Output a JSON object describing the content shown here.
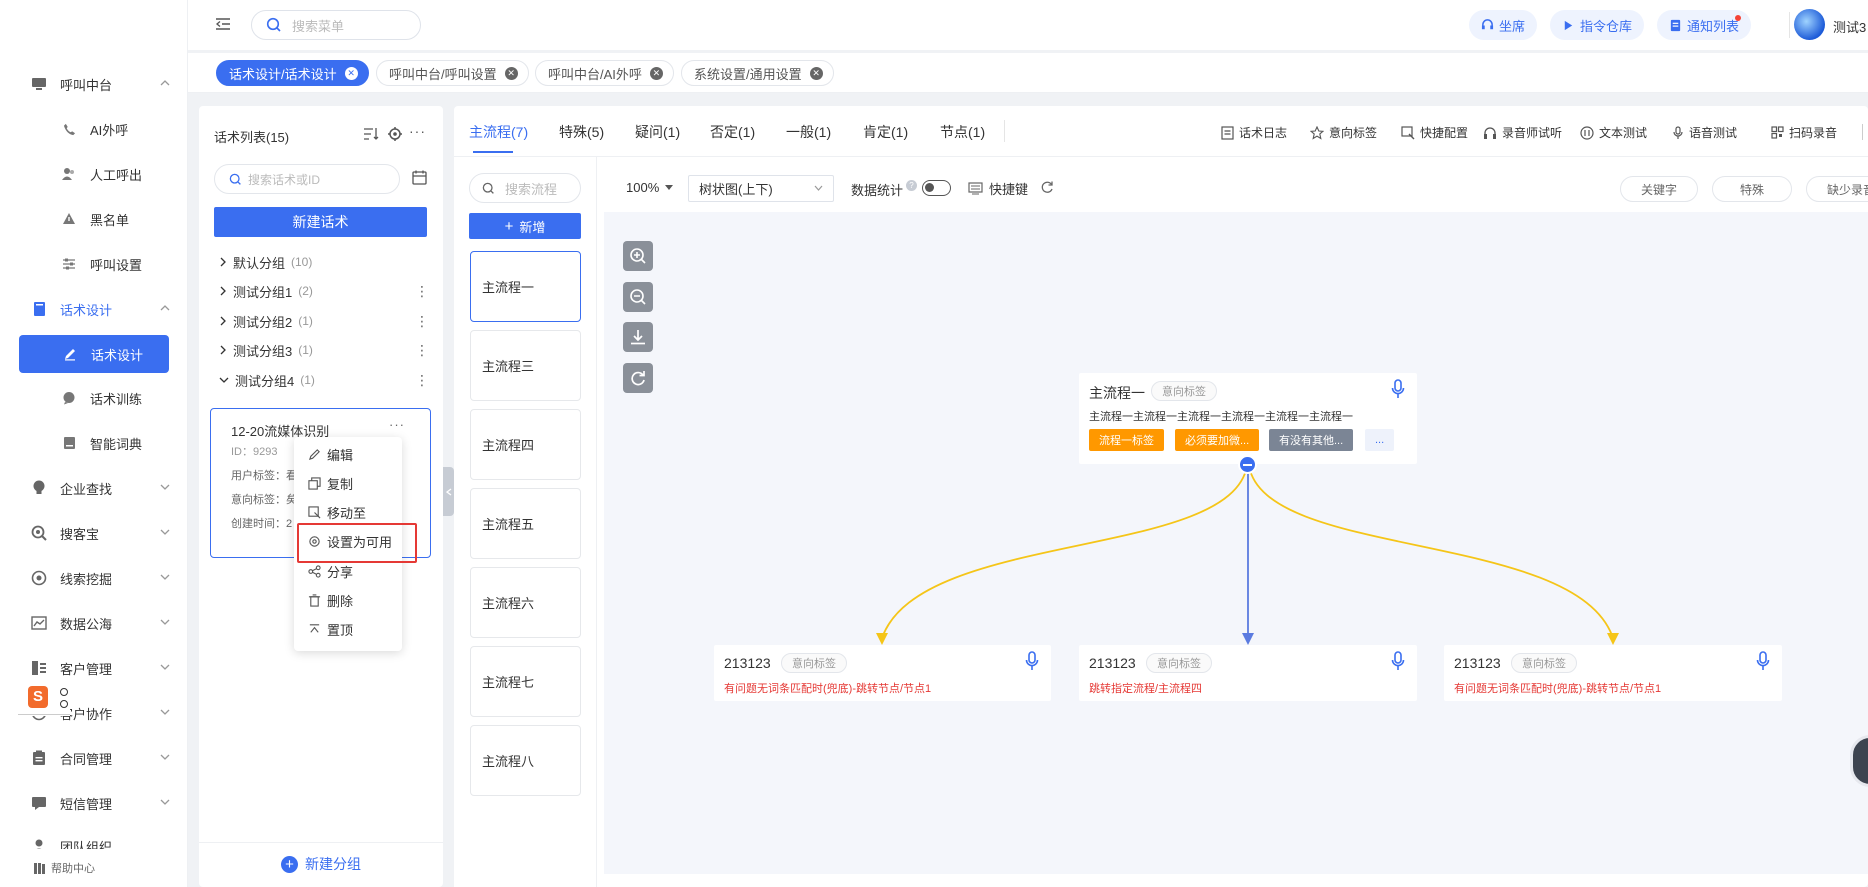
{
  "sidebar": {
    "items": [
      {
        "label": "呼叫中台",
        "icon": "monitor-icon"
      },
      {
        "label": "AI外呼",
        "icon": "phone-icon"
      },
      {
        "label": "人工呼出",
        "icon": "people-icon"
      },
      {
        "label": "黑名单",
        "icon": "warning-icon"
      },
      {
        "label": "呼叫设置",
        "icon": "sliders-icon"
      },
      {
        "label": "话术设计",
        "icon": "book-icon"
      },
      {
        "label": "话术设计",
        "icon": "edit-icon"
      },
      {
        "label": "话术训练",
        "icon": "chat-icon"
      },
      {
        "label": "智能词典",
        "icon": "dictionary-icon"
      },
      {
        "label": "企业查找",
        "icon": "bulb-icon"
      },
      {
        "label": "搜客宝",
        "icon": "search-circle-icon"
      },
      {
        "label": "线索挖掘",
        "icon": "target-icon"
      },
      {
        "label": "数据公海",
        "icon": "chart-icon"
      },
      {
        "label": "客户管理",
        "icon": "customer-icon"
      },
      {
        "label": "客户协作",
        "icon": "collab-icon"
      },
      {
        "label": "合同管理",
        "icon": "contract-icon"
      },
      {
        "label": "短信管理",
        "icon": "sms-icon"
      },
      {
        "label": "团队组织",
        "icon": "team-icon"
      }
    ],
    "help": "帮助中心"
  },
  "header": {
    "search_placeholder": "搜索菜单",
    "seat": "坐席",
    "command": "指令仓库",
    "notify": "通知列表",
    "user": "测试3"
  },
  "tabs": [
    {
      "label": "话术设计/话术设计",
      "active": true
    },
    {
      "label": "呼叫中台/呼叫设置",
      "active": false
    },
    {
      "label": "呼叫中台/AI外呼",
      "active": false
    },
    {
      "label": "系统设置/通用设置",
      "active": false
    }
  ],
  "script_list": {
    "title": "话术列表(15)",
    "search_placeholder": "搜索话术或ID",
    "new_btn": "新建话术",
    "groups": [
      {
        "name": "默认分组",
        "count": "(10)"
      },
      {
        "name": "测试分组1",
        "count": "(2)"
      },
      {
        "name": "测试分组2",
        "count": "(1)"
      },
      {
        "name": "测试分组3",
        "count": "(1)"
      },
      {
        "name": "测试分组4",
        "count": "(1)"
      }
    ],
    "card": {
      "name": "12-20流媒体识别",
      "id": "ID：9293",
      "user_tag": "用户标签：看",
      "intent_tag": "意向标签：矣",
      "created": "创建时间：2"
    },
    "menu": [
      "编辑",
      "复制",
      "移动至",
      "设置为可用",
      "分享",
      "删除",
      "置顶"
    ],
    "new_group": "新建分组"
  },
  "main": {
    "tabs": [
      "主流程(7)",
      "特殊(5)",
      "疑问(1)",
      "否定(1)",
      "一般(1)",
      "肯定(1)",
      "节点(1)"
    ],
    "tools": [
      "话术日志",
      "意向标签",
      "快捷配置",
      "录音师试听",
      "文本测试",
      "语音测试",
      "扫码录音"
    ],
    "flow_search_placeholder": "搜索流程",
    "add_btn": "新增",
    "flows": [
      "主流程一",
      "主流程三",
      "主流程四",
      "主流程五",
      "主流程六",
      "主流程七",
      "主流程八"
    ],
    "zoom": "100%",
    "layout": "树状图(上下)",
    "stats_label": "数据统计",
    "shortcut_label": "快捷键",
    "pills": [
      "关键字",
      "特殊",
      "缺少录音"
    ]
  },
  "graph": {
    "root": {
      "title": "主流程一",
      "intent": "意向标签",
      "content": "主流程一主流程一主流程一主流程一主流程一主流程一",
      "chips": [
        "流程一标签",
        "必须要加微...",
        "有没有其他...",
        "..."
      ]
    },
    "children": [
      {
        "title": "213123",
        "intent": "意向标签",
        "desc": "有问题无词条匹配时(兜底)-跳转节点/节点1"
      },
      {
        "title": "213123",
        "intent": "意向标签",
        "desc": "跳转指定流程/主流程四"
      },
      {
        "title": "213123",
        "intent": "意向标签",
        "desc": "有问题无词条匹配时(兜底)-跳转节点/节点1"
      }
    ]
  },
  "colors": {
    "accent": "#3a6ef0",
    "orange": "#ff9800",
    "chip_gray": "#7b8595",
    "edge_yellow": "#f5c518",
    "highlight": "#e53935",
    "desc_red": "#e53935"
  }
}
